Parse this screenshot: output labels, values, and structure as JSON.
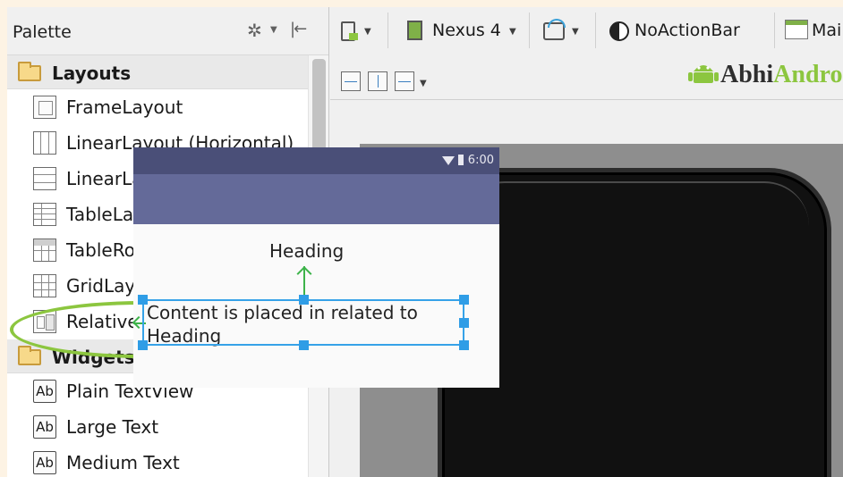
{
  "palette": {
    "title": "Palette",
    "categories": [
      {
        "label": "Layouts",
        "items": [
          {
            "label": "FrameLayout",
            "icon": "frame-layout-icon"
          },
          {
            "label": "LinearLayout (Horizontal)",
            "icon": "linear-layout-horizontal-icon"
          },
          {
            "label": "LinearLayout (Vertical)",
            "icon": "linear-layout-vertical-icon"
          },
          {
            "label": "TableLayout",
            "icon": "table-layout-icon"
          },
          {
            "label": "TableRow",
            "icon": "table-row-icon"
          },
          {
            "label": "GridLayout",
            "icon": "grid-layout-icon"
          },
          {
            "label": "RelativeLayout",
            "icon": "relative-layout-icon",
            "highlighted": true
          }
        ]
      },
      {
        "label": "Widgets",
        "items": [
          {
            "label": "Plain TextView",
            "icon_text": "Ab"
          },
          {
            "label": "Large Text",
            "icon_text": "Ab"
          },
          {
            "label": "Medium Text",
            "icon_text": "Ab"
          }
        ]
      }
    ]
  },
  "toolbar": {
    "device": "Nexus 4",
    "theme": "NoActionBar",
    "activity": "Mai"
  },
  "logo": {
    "part1": "Abhi",
    "part2": "Android"
  },
  "device_screen": {
    "time": "6:00",
    "heading": "Heading",
    "content": "Content is placed in related to Heading"
  },
  "colors": {
    "highlight_ellipse": "#8cc63f",
    "selection": "#36a2e8",
    "constraint_arrow": "#3db34a",
    "app_bar": "#646a99",
    "status_bar": "#4a4f78"
  }
}
